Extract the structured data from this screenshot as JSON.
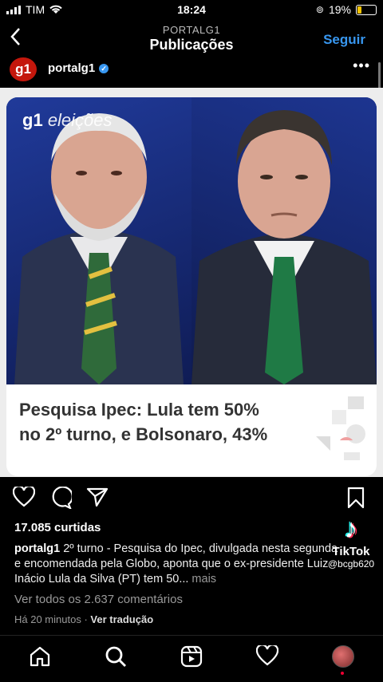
{
  "status": {
    "carrier": "TIM",
    "time": "18:24",
    "battery": "19%",
    "battery_level": 0.19
  },
  "header": {
    "subtitle": "PORTALG1",
    "title": "Publicações",
    "follow_label": "Seguir"
  },
  "post": {
    "avatar_text": "g1",
    "username": "portalg1",
    "image_brand": "g1",
    "image_brand_suffix": "eleições",
    "headline_line1": "Pesquisa Ipec: Lula tem 50%",
    "headline_line2": "no 2º turno, e Bolsonaro, 43%",
    "likes": "17.085 curtidas",
    "caption_user": "portalg1",
    "caption_text": " 2º turno - Pesquisa do Ipec, divulgada nesta segunda e encomendada pela Globo, aponta que o ex-presidente Luiz Inácio Lula da Silva (PT) tem 50...",
    "caption_more": " mais",
    "comments_link": "Ver todos os 2.637 comentários",
    "time_ago": "Há 20 minutos",
    "separator": " · ",
    "translate": "Ver tradução"
  },
  "watermark": {
    "app": "TikTok",
    "handle": "@bcgb620"
  },
  "colors": {
    "accent": "#3897f0",
    "brand": "#c4170c"
  }
}
